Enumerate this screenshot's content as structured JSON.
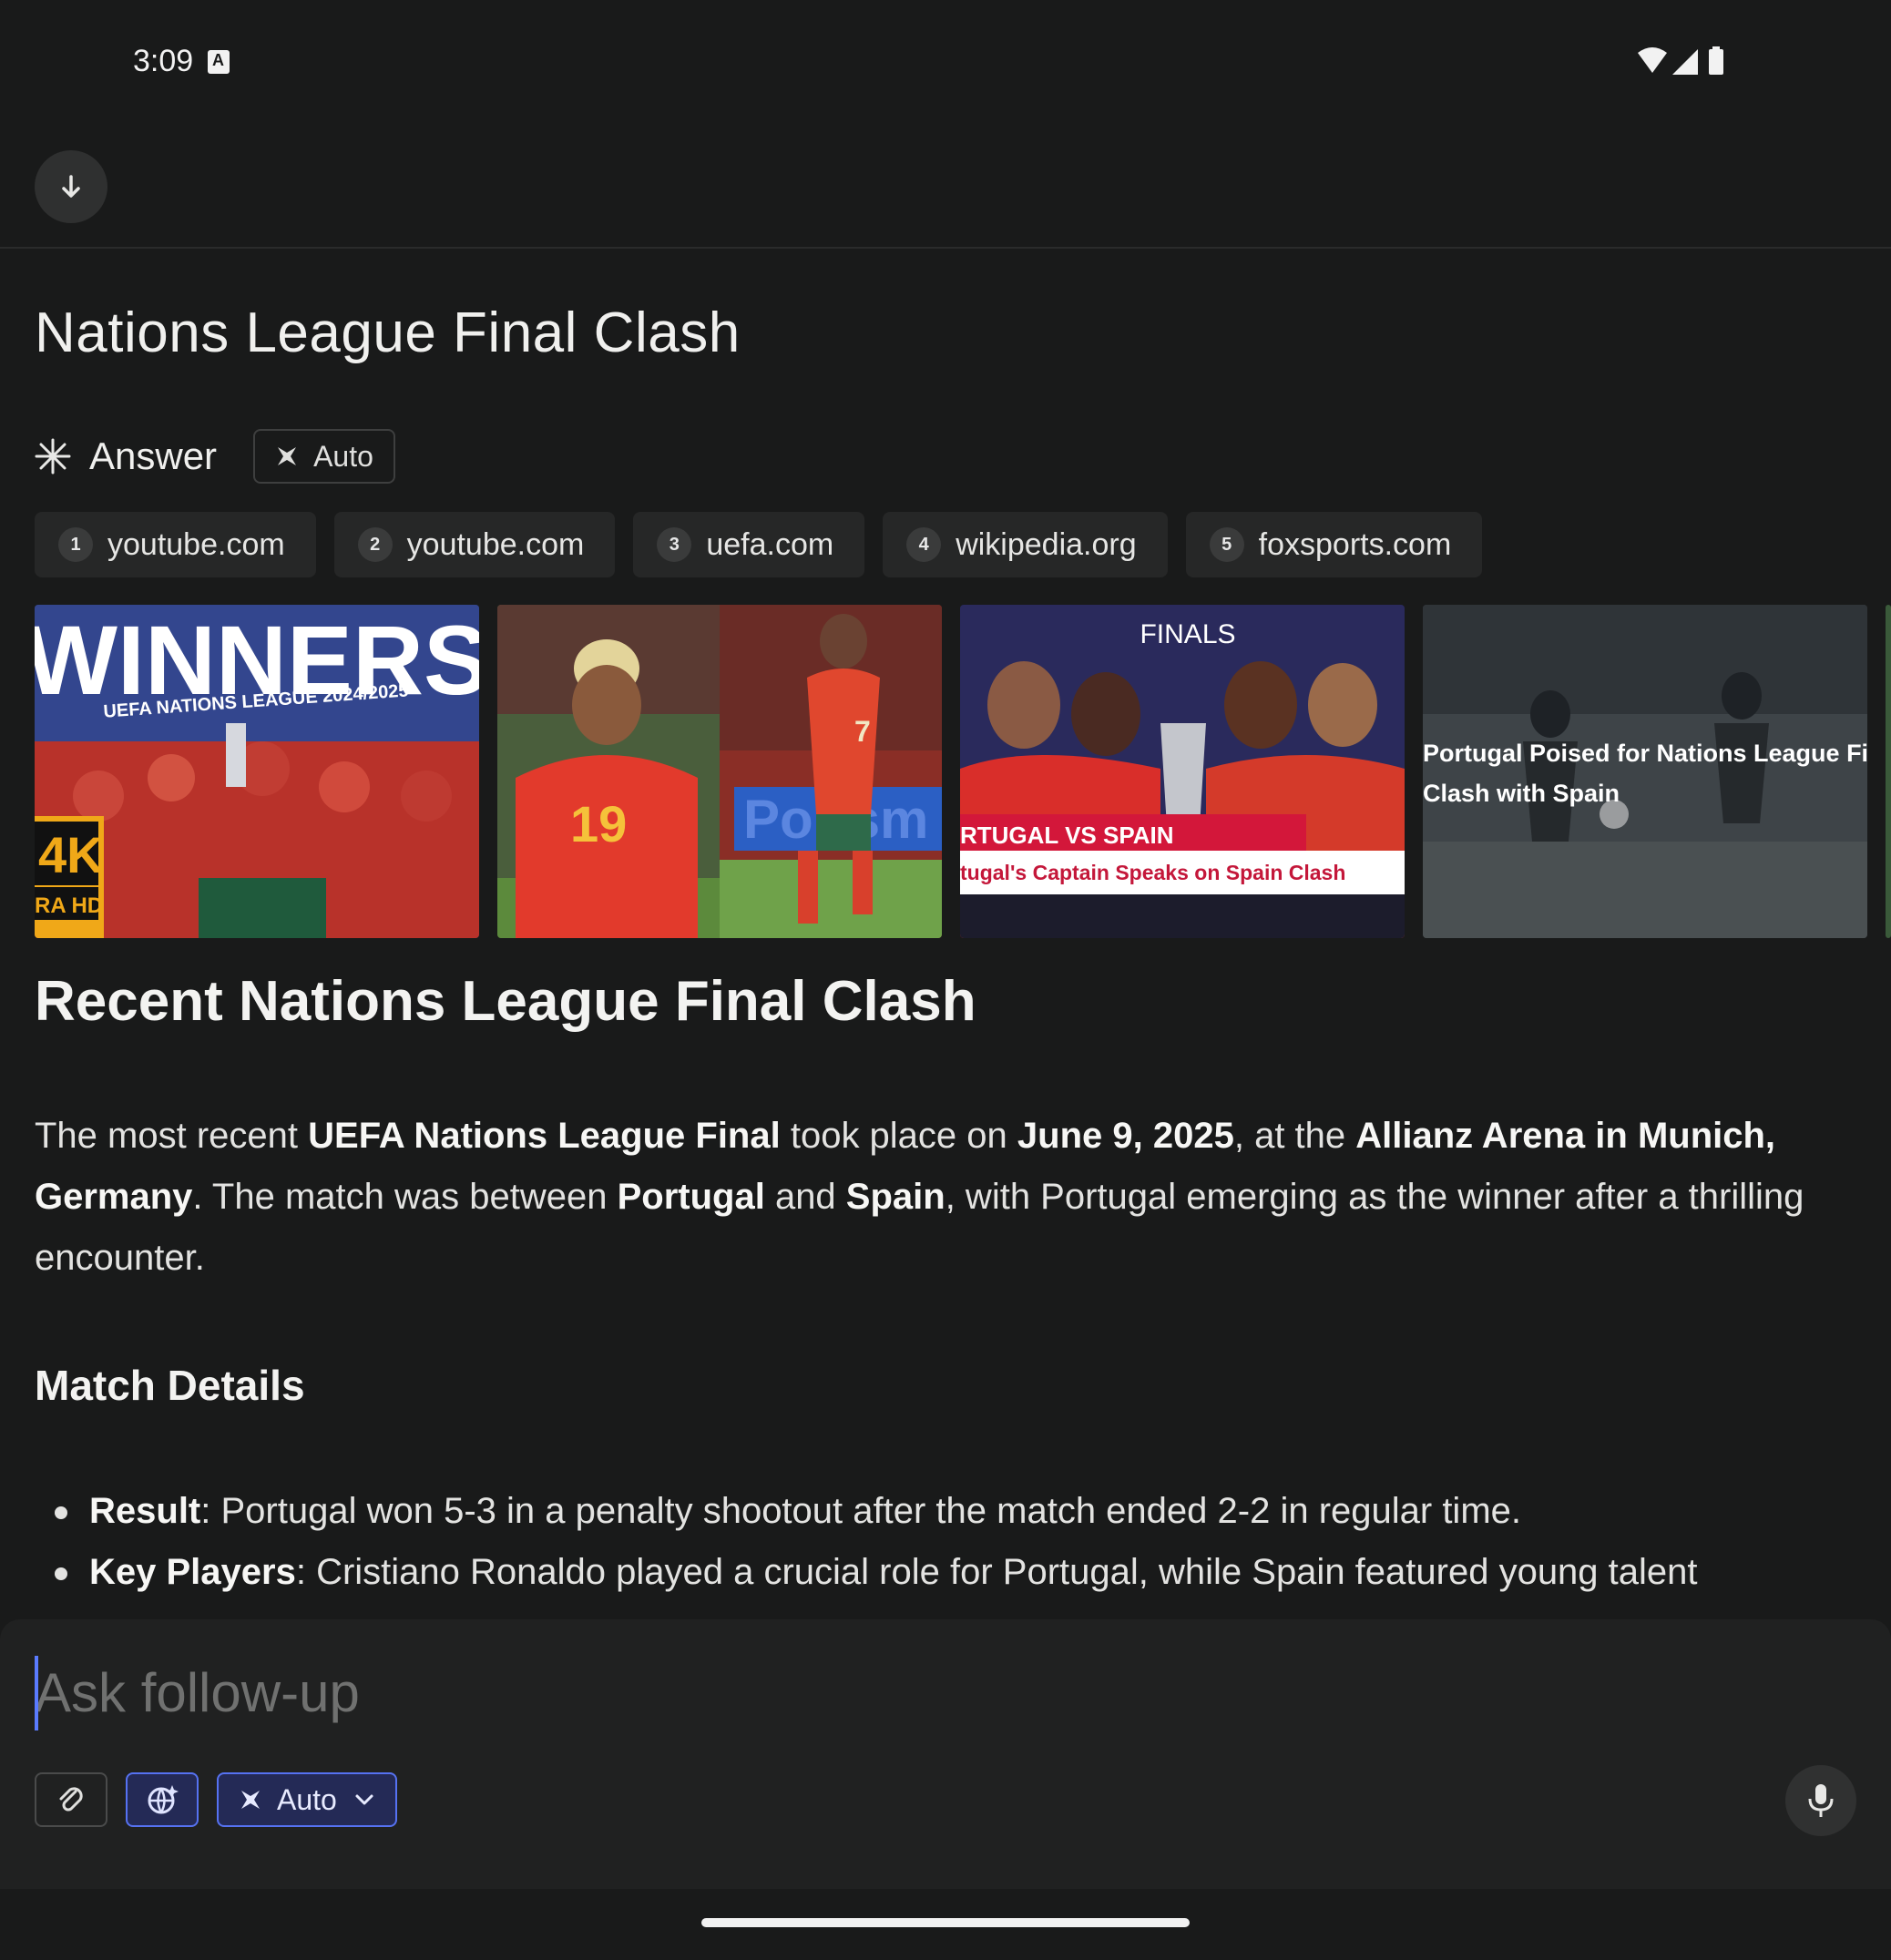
{
  "status_bar": {
    "time": "3:09",
    "icons": [
      "notification-a-icon",
      "wifi-icon",
      "signal-icon",
      "battery-icon"
    ]
  },
  "toolbar": {
    "collapse_icon": "arrow-down-icon"
  },
  "query": {
    "title": "Nations League Final Clash"
  },
  "answer": {
    "label": "Answer",
    "mode_chip": "Auto"
  },
  "sources": [
    {
      "num": "1",
      "domain": "youtube.com"
    },
    {
      "num": "2",
      "domain": "youtube.com"
    },
    {
      "num": "3",
      "domain": "uefa.com"
    },
    {
      "num": "4",
      "domain": "wikipedia.org"
    },
    {
      "num": "5",
      "domain": "foxsports.com"
    }
  ],
  "media": [
    {
      "top_text": "WINNERS",
      "sub_text": "UEFA NATIONS LEAGUE 2024/2025",
      "badge_1": "4K",
      "badge_2": "RA HD"
    },
    {
      "jersey_1": "19",
      "jersey_2": "7",
      "sign_text": "Por sm"
    },
    {
      "header": "FINALS",
      "banner_1": "RTUGAL VS SPAIN",
      "banner_2": "tugal's Captain Speaks on Spain Clash"
    },
    {
      "overlay_1": "Portugal Poised for Nations League Fina",
      "overlay_2": "Clash with Spain"
    }
  ],
  "content": {
    "heading": "Recent Nations League Final Clash",
    "p1": {
      "t1": "The most recent ",
      "b1": "UEFA Nations League Final",
      "t2": " took place on ",
      "b2": "June 9, 2025",
      "t3": ", at the ",
      "b3": "Allianz Arena in Munich, Germany",
      "t4": ". The match was between ",
      "b4": "Portugal",
      "t5": " and ",
      "b5": "Spain",
      "t6": ", with Portugal emerging as the winner after a thrilling encounter."
    },
    "subheading": "Match Details",
    "bullets": [
      {
        "label": "Result",
        "text": ": Portugal won 5-3 in a penalty shootout after the match ended 2-2 in regular time."
      },
      {
        "label": "Key Players",
        "text": ": Cristiano Ronaldo played a crucial role for Portugal, while Spain featured young talent"
      }
    ]
  },
  "composer": {
    "placeholder": "Ask follow-up",
    "mode_label": "Auto",
    "tools": [
      "attach-icon",
      "web-search-icon",
      "mode-icon",
      "chevron-down-icon",
      "mic-icon"
    ]
  },
  "colors": {
    "background": "#191a1a",
    "accent": "#5672f2",
    "chip_bg": "#262727"
  }
}
